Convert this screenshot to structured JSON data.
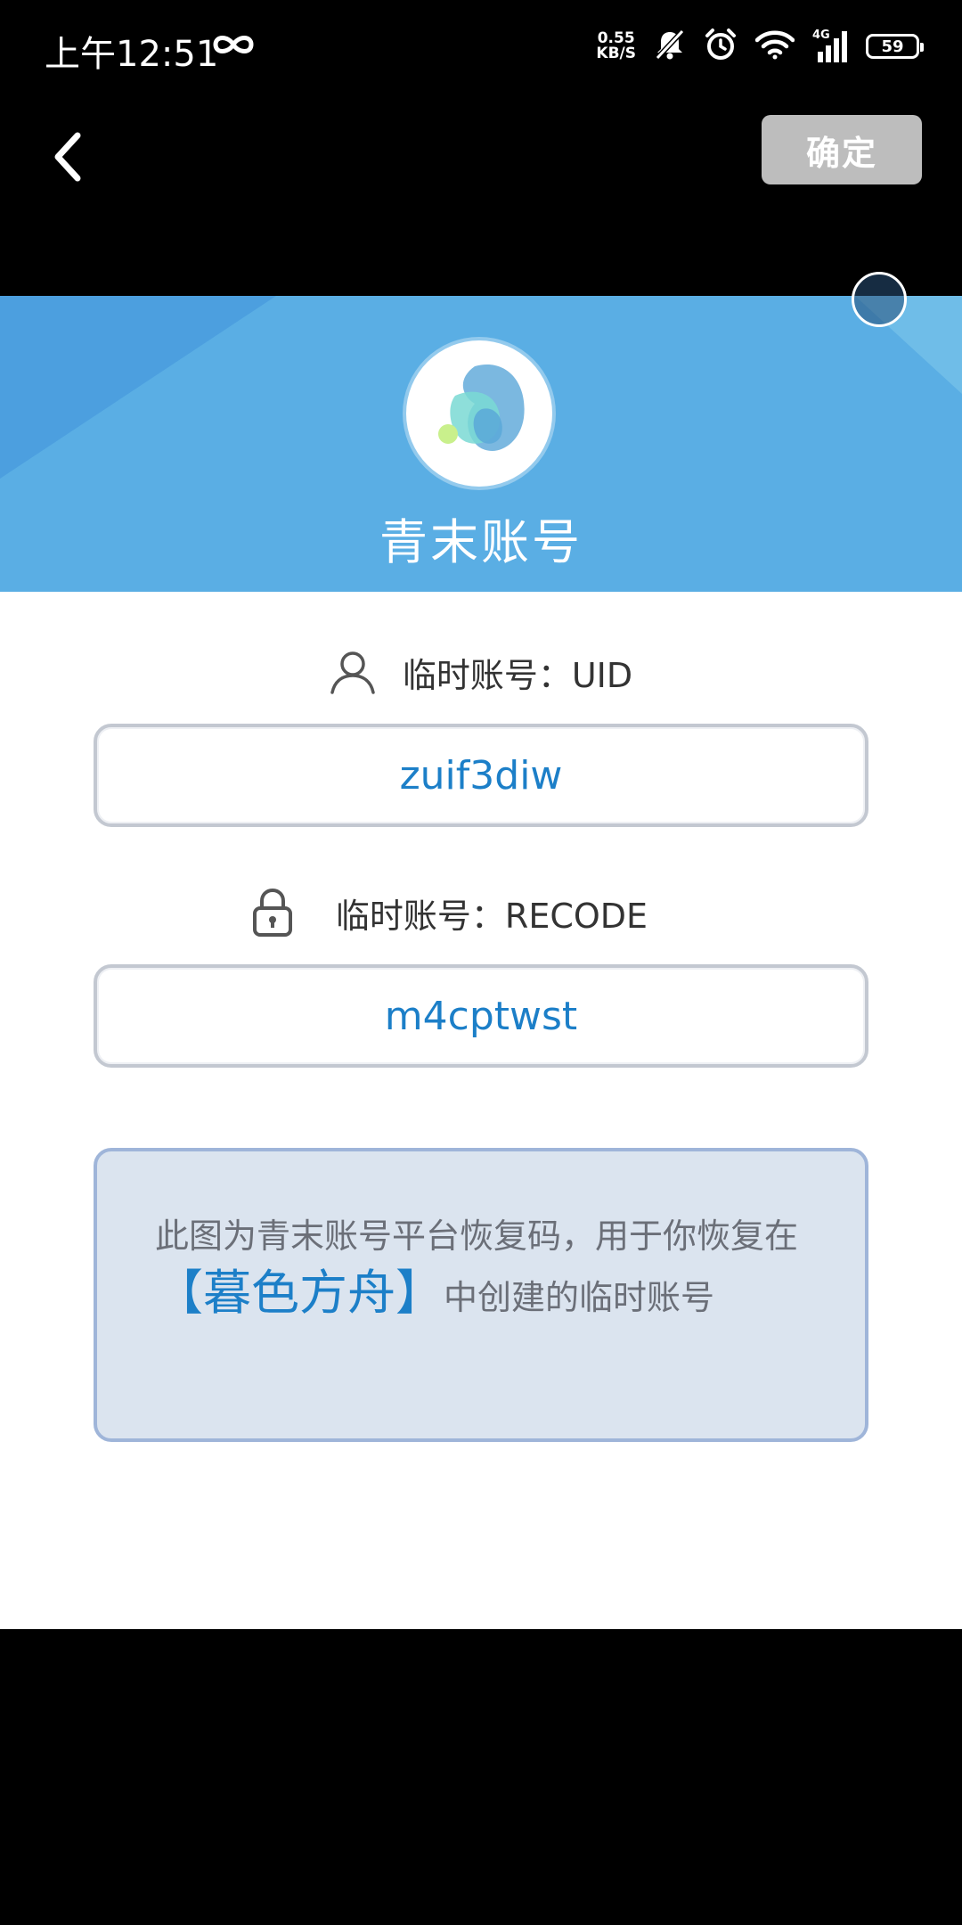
{
  "status_bar": {
    "time": "上午12:51",
    "net_speed_value": "0.55",
    "net_speed_unit": "KB/S",
    "network_type": "4G",
    "battery": "59",
    "icons": [
      "infinity-icon",
      "mute-bell-icon",
      "alarm-icon",
      "wifi-icon",
      "signal-icon",
      "battery-icon"
    ]
  },
  "app_bar": {
    "back_icon": "chevron-left-icon",
    "confirm_label": "确定"
  },
  "header": {
    "title": "青末账号",
    "logo": "app-logo",
    "bg_color": "#5aaee4"
  },
  "uid": {
    "label": "临时账号：UID",
    "value": "zuif3diw",
    "icon": "user-icon"
  },
  "recode": {
    "label": "临时账号：RECODE",
    "value": "m4cptwst",
    "icon": "lock-icon"
  },
  "notice": {
    "text_before": "此图为青末账号平台恢复码，用于你恢复在",
    "highlight": "【暮色方舟】",
    "text_after": "中创建的临时账号"
  },
  "colors": {
    "accent": "#1c7fc8",
    "confirm_disabled": "#bdbdbd"
  }
}
